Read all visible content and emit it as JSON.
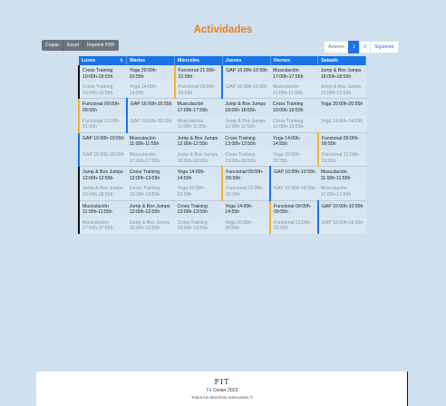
{
  "title": "Actividades",
  "toolbar": {
    "copy_label": "Copiar",
    "excel_label": "Excel",
    "pdf_label": "Imprimir PDF"
  },
  "pager": {
    "prev": "Anterior",
    "pages": [
      "1",
      "2"
    ],
    "next": "Siguiente"
  },
  "table": {
    "columns": [
      "Lunes",
      "Martes",
      "Miercoles",
      "Jueves",
      "Viernes",
      "Sabado"
    ],
    "rows": [
      [
        "Cross Training 19:00h-19:55h",
        "Yoga 20:00h-20:55h",
        "Funcional 21:00h-21:55h",
        "GAP 16:00h-16:55h",
        "Musculación 17:00h-17:55h",
        "Jump & Box Jumps 18:00h-18:55h"
      ],
      [
        "Cross Training 19:00h-19:55h",
        "Yoga 14:00h-14:55h",
        "Funcional 09:00h-09:55h",
        "GAP 10:00h-10:55h",
        "Musculación 11:00h-11:55h",
        "Jump & Box Jumps 12:00h-12:55h"
      ],
      [
        "Funcional 09:00h-09:55h",
        "GAP 16:00h-16:55h",
        "Musculación 17:00h-17:55h",
        "Jump & Box Jumps 18:00h-18:55h",
        "Cross Training 19:00h-19:55h",
        "Yoga 20:00h-20:55h"
      ],
      [
        "Funcional 21:00h-21:55h",
        "GAP 10:00h-10:55h",
        "Musculación 11:00h-11:55h",
        "Jump & Box Jumps 12:00h-12:55h",
        "Cross Training 13:00h-13:55h",
        "Yoga 14:00h-14:55h"
      ],
      [
        "GAP 10:00h-10:55h",
        "Musculación 11:00h-11:55h",
        "Jump & Box Jumps 12:00h-12:55h",
        "Cross Training 13:00h-13:55h",
        "Yoga 14:00h-14:55h",
        "Funcional 09:00h-09:55h"
      ],
      [
        "GAP 16:00h-16:55h",
        "Musculación 17:00h-17:55h",
        "Jump & Box Jumps 18:00h-18:55h",
        "Cross Training 19:00h-19:55h",
        "Yoga 20:00h-20:55h",
        "Funcional 21:00h-21:55h"
      ],
      [
        "Jump & Box Jumps 12:00h-12:55h",
        "Cross Training 13:00h-13:55h",
        "Yoga 14:00h-14:55h",
        "Funcional 09:00h-09:55h",
        "GAP 10:00h-10:55h",
        "Musculación 11:00h-11:55h"
      ],
      [
        "Jump & Box Jumps 18:00h-18:55h",
        "Cross Training 19:00h-19:55h",
        "Yoga 20:00h-20:55h",
        "Funcional 21:00h-21:55h",
        "GAP 16:00h-16:55h",
        "Musculación 17:00h-17:55h"
      ],
      [
        "Musculación 11:00h-11:55h",
        "Jump & Box Jumps 12:00h-12:55h",
        "Cross Training 13:00h-13:55h",
        "Yoga 14:00h-14:55h",
        "Funcional 09:00h-09:55h",
        "GAP 10:00h-10:55h"
      ],
      [
        "Musculación 17:00h-17:55h",
        "Jump & Box Jumps 18:00h-18:55h",
        "Cross Training 19:00h-19:55h",
        "Yoga 20:00h-20:55h",
        "Funcional 21:00h-21:55h",
        "GAP 16:00h-16:55h"
      ]
    ]
  },
  "footer": {
    "logo": "FIT",
    "copyright_name": "Fit",
    "copyright_rest": "Center 2023",
    "rights": "Todos los derechos reservados ©"
  },
  "colors": {
    "accent": "#1a73e8",
    "title": "#f07d1a",
    "funcional_marker": "#f2b233",
    "gap_marker": "#1a73e8"
  }
}
